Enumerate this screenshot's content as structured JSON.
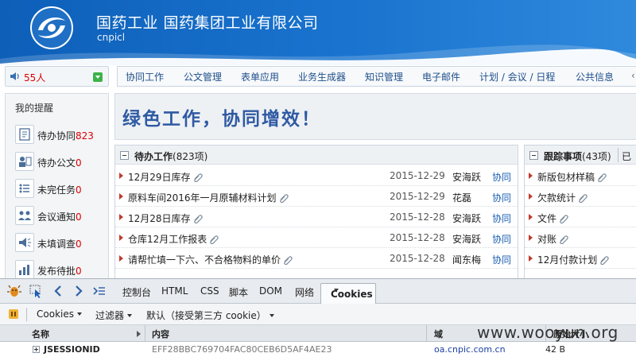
{
  "header": {
    "title": "国药工业  国药集团工业有限公司",
    "subtitle": "cnpicl"
  },
  "online": {
    "count": "55人"
  },
  "nav": {
    "items": [
      "协同工作",
      "公文管理",
      "表单应用",
      "业务生成器",
      "知识管理",
      "电子邮件",
      "计划 / 会议 / 日程",
      "公共信息"
    ]
  },
  "sidebar": {
    "title": "我的提醒",
    "items": [
      {
        "label": "待办协同",
        "count": "823",
        "icon": "todo-collab-icon"
      },
      {
        "label": "待办公文",
        "count": "0",
        "icon": "todo-document-icon"
      },
      {
        "label": "未完任务",
        "count": "0",
        "icon": "unfinished-task-icon"
      },
      {
        "label": "会议通知",
        "count": "0",
        "icon": "meeting-notice-icon"
      },
      {
        "label": "未填调查",
        "count": "0",
        "icon": "survey-icon"
      },
      {
        "label": "发布待批",
        "count": "0",
        "icon": "publish-approval-icon"
      }
    ]
  },
  "slogan": "绿色工作，协同增效！",
  "pending": {
    "title": "待办工作",
    "count": "(823项)",
    "rows": [
      {
        "subject": "12月29日库存",
        "date": "2015-12-29",
        "person": "安海跃",
        "type": "协同"
      },
      {
        "subject": "原料车间2016年一月原辅材料计划",
        "date": "2015-12-29",
        "person": "花磊",
        "type": "协同"
      },
      {
        "subject": "12月28日库存",
        "date": "2015-12-28",
        "person": "安海跃",
        "type": "协同"
      },
      {
        "subject": "仓库12月工作报表",
        "date": "2015-12-28",
        "person": "安海跃",
        "type": "协同"
      },
      {
        "subject": "请帮忙填一下六、不合格物料的单价",
        "date": "2015-12-28",
        "person": "闻东梅",
        "type": "协同"
      }
    ]
  },
  "tracking": {
    "title": "跟踪事项",
    "count": "(43项)",
    "tab2": "已",
    "rows": [
      {
        "subject": "新版包材样稿"
      },
      {
        "subject": "欠款统计"
      },
      {
        "subject": "文件"
      },
      {
        "subject": "对账"
      },
      {
        "subject": "12月付款计划"
      }
    ]
  },
  "devtools": {
    "tabs": [
      "控制台",
      "HTML",
      "CSS",
      "脚本",
      "DOM",
      "网络"
    ],
    "active_tab": "Cookies",
    "toolbar": [
      "Cookies",
      "过滤器",
      "默认（接受第三方 cookie）"
    ],
    "columns": [
      "名称",
      "内容",
      "域",
      "原始大小"
    ],
    "row": {
      "name": "JSESSIONID",
      "value": "EFF28BBC769704FAC80CEB6D5AF4AE23",
      "domain": "oa.cnpic.com.cn",
      "size": "42 B"
    }
  },
  "watermark": "www.wooyun.org",
  "colors": {
    "brand_blue": "#1a6fca",
    "count_red": "#dd0000",
    "slogan_blue": "#2f5aa3",
    "link_blue": "#1a5fb4"
  }
}
